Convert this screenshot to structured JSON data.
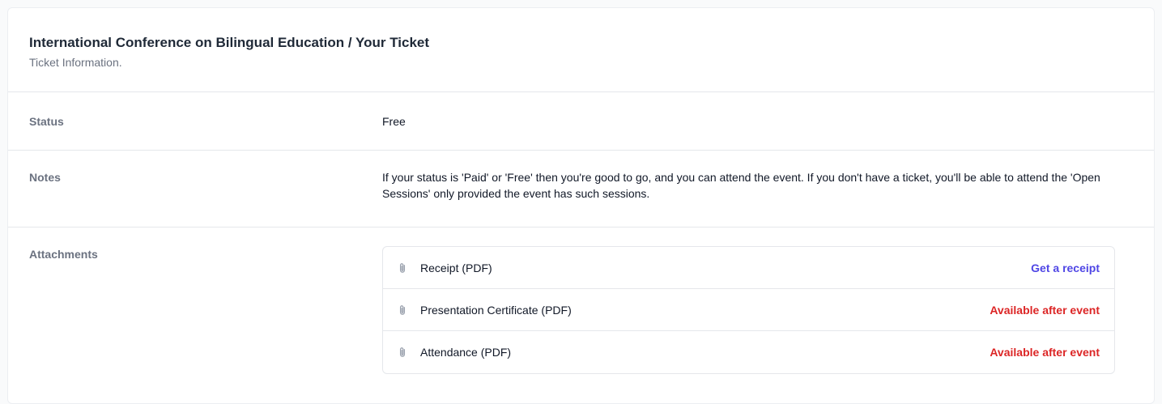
{
  "header": {
    "title": "International Conference on Bilingual Education / Your Ticket",
    "subtitle": "Ticket Information."
  },
  "rows": {
    "status": {
      "label": "Status",
      "value": "Free"
    },
    "notes": {
      "label": "Notes",
      "value": "If your status is 'Paid' or 'Free' then you're good to go, and you can attend the event. If you don't have a ticket, you'll be able to attend the 'Open Sessions' only provided the event has such sessions."
    },
    "attachments": {
      "label": "Attachments",
      "items": [
        {
          "name": "Receipt (PDF)",
          "action": "Get a receipt",
          "icon": "paperclip-icon"
        },
        {
          "name": "Presentation Certificate (PDF)",
          "action": "Available after event",
          "icon": "paperclip-icon"
        },
        {
          "name": "Attendance (PDF)",
          "action": "Available after event",
          "icon": "paperclip-icon"
        }
      ]
    }
  },
  "colors": {
    "link": "#4f46e5",
    "unavailable": "#dc2626"
  }
}
